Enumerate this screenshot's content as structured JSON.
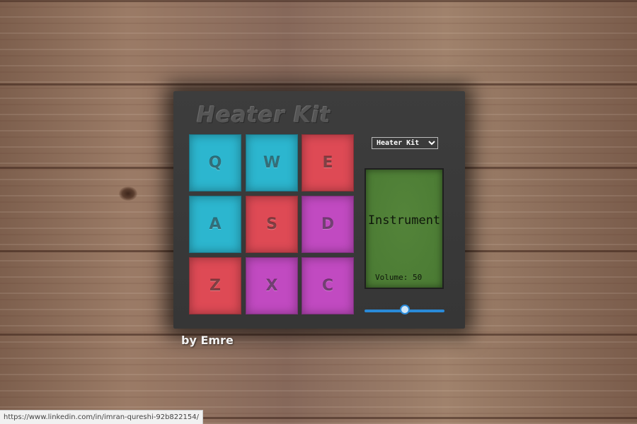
{
  "app": {
    "title": "Heater Kit",
    "byline": "by Emre"
  },
  "pads": [
    {
      "key": "Q",
      "color": "#2cb6cf"
    },
    {
      "key": "W",
      "color": "#2cb6cf"
    },
    {
      "key": "E",
      "color": "#de4a55"
    },
    {
      "key": "A",
      "color": "#2cb6cf"
    },
    {
      "key": "S",
      "color": "#de4a55"
    },
    {
      "key": "D",
      "color": "#c14ac1"
    },
    {
      "key": "Z",
      "color": "#de4a55"
    },
    {
      "key": "X",
      "color": "#c14ac1"
    },
    {
      "key": "C",
      "color": "#c14ac1"
    }
  ],
  "controls": {
    "kit_select": {
      "selected": "Heater Kit",
      "icon": "chevron-down-icon"
    },
    "display": {
      "text": "Instrument",
      "volume_text": "Volume: 50",
      "color": "#4a7a33"
    },
    "volume_slider": {
      "value": 50,
      "min": 0,
      "max": 100,
      "accent": "#2a8ad8"
    }
  },
  "status_bar": {
    "url": "https://www.linkedin.com/in/imran-qureshi-92b822154/"
  }
}
